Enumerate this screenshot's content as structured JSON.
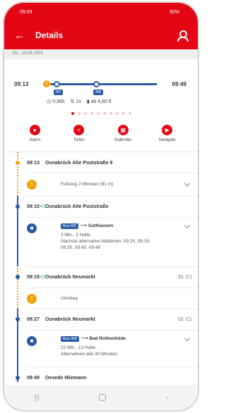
{
  "status": {
    "time": "09:09",
    "right": "90%"
  },
  "header": {
    "title": "Details"
  },
  "date": "Do., 14.08.2024",
  "summary": {
    "dep": "09:13",
    "arr": "09:49",
    "badge1": "M3",
    "badge2": "466",
    "duration": "0:36h",
    "changes": "1x",
    "price": "ab 4,60 €"
  },
  "actions": [
    "Alarm",
    "Teilen",
    "Kalender",
    "Navigate"
  ],
  "route": {
    "s1": {
      "time": "09:13",
      "name": "Osnabrück Alte Poststraße 9"
    },
    "walk": {
      "text": "Fußweg 2 Minuten (91 m)"
    },
    "s2": {
      "time": "09:15",
      "delay": "+0",
      "name": "Osnabrück Alte Poststraße"
    },
    "bus1": {
      "badge": "Bus M3",
      "dest": "Sutthausen",
      "l1": "3 Min., 2 Halte",
      "l2": "Nächste alternative Abfahrten: 09:25, 09:29,",
      "l3": "09:35, 09:45, 09:49"
    },
    "s3": {
      "time": "09:18",
      "delay": "+0",
      "name": "Osnabrück Neumarkt",
      "track": "Gl. C1"
    },
    "transfer": {
      "text": "Umstieg"
    },
    "s4": {
      "time": "09:27",
      "name": "Osnabrück Neumarkt",
      "track": "Gl. C1"
    },
    "bus2": {
      "badge": "Bus 466",
      "dest": "Bad Rothenfelde",
      "l1": "22 Min., 13 Halte",
      "l2": "Alternativen alle 30 Minuten"
    },
    "s5": {
      "time": "09:49",
      "name": "Oesede Wiemann"
    }
  },
  "colors": {
    "brand": "#e30613",
    "line": "#2a5aa8",
    "walk": "#f0a30a"
  }
}
